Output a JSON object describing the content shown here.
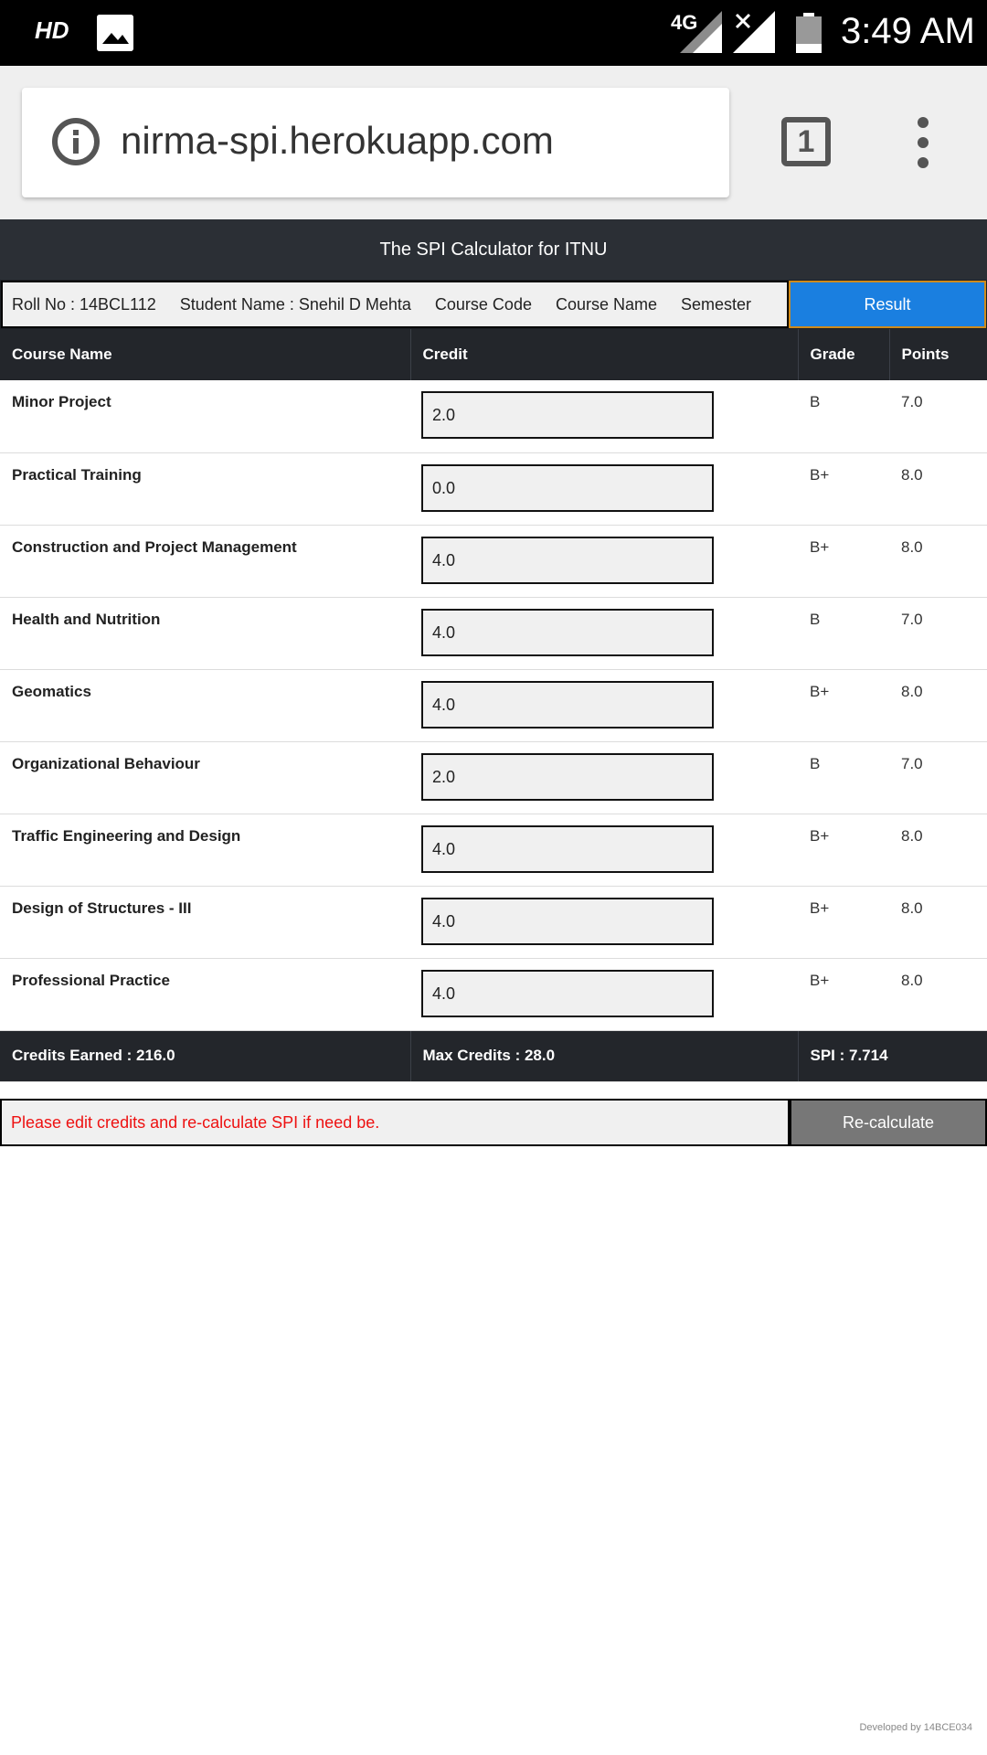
{
  "status_bar": {
    "hd": "HD",
    "network": "4G",
    "time": "3:49 AM"
  },
  "browser": {
    "url": "nirma-spi.herokuapp.com",
    "tab_count": "1"
  },
  "app": {
    "title": "The SPI Calculator for ITNU",
    "roll_no": "Roll No : 14BCL112",
    "student_name": "Student Name : Snehil D Mehta",
    "course_code": "Course Code",
    "course_name": "Course Name",
    "semester": "Semester",
    "result_label": "Result"
  },
  "table": {
    "headers": [
      "Course Name",
      "Credit",
      "Grade",
      "Points"
    ],
    "rows": [
      {
        "course": "Minor Project",
        "credit": "2.0",
        "grade": "B",
        "points": "7.0"
      },
      {
        "course": "Practical Training",
        "credit": "0.0",
        "grade": "B+",
        "points": "8.0"
      },
      {
        "course": "Construction and Project Management",
        "credit": "4.0",
        "grade": "B+",
        "points": "8.0"
      },
      {
        "course": "Health and Nutrition",
        "credit": "4.0",
        "grade": "B",
        "points": "7.0"
      },
      {
        "course": "Geomatics",
        "credit": "4.0",
        "grade": "B+",
        "points": "8.0"
      },
      {
        "course": "Organizational Behaviour",
        "credit": "2.0",
        "grade": "B",
        "points": "7.0"
      },
      {
        "course": "Traffic Engineering and Design",
        "credit": "4.0",
        "grade": "B+",
        "points": "8.0"
      },
      {
        "course": "Design of Structures - III",
        "credit": "4.0",
        "grade": "B+",
        "points": "8.0"
      },
      {
        "course": "Professional Practice",
        "credit": "4.0",
        "grade": "B+",
        "points": "8.0"
      }
    ],
    "footer": {
      "credits_earned": "Credits Earned : 216.0",
      "max_credits": "Max Credits : 28.0",
      "spi": "SPI : 7.714"
    }
  },
  "recalc": {
    "message": "Please edit credits and re-calculate SPI if need be.",
    "button": "Re-calculate"
  },
  "developer_note": "Developed by 14BCE034",
  "colors": {
    "header_bg": "#23262b",
    "result_button": "#1a7fe0",
    "recalc_button": "#777777",
    "message_text": "#e11111"
  }
}
